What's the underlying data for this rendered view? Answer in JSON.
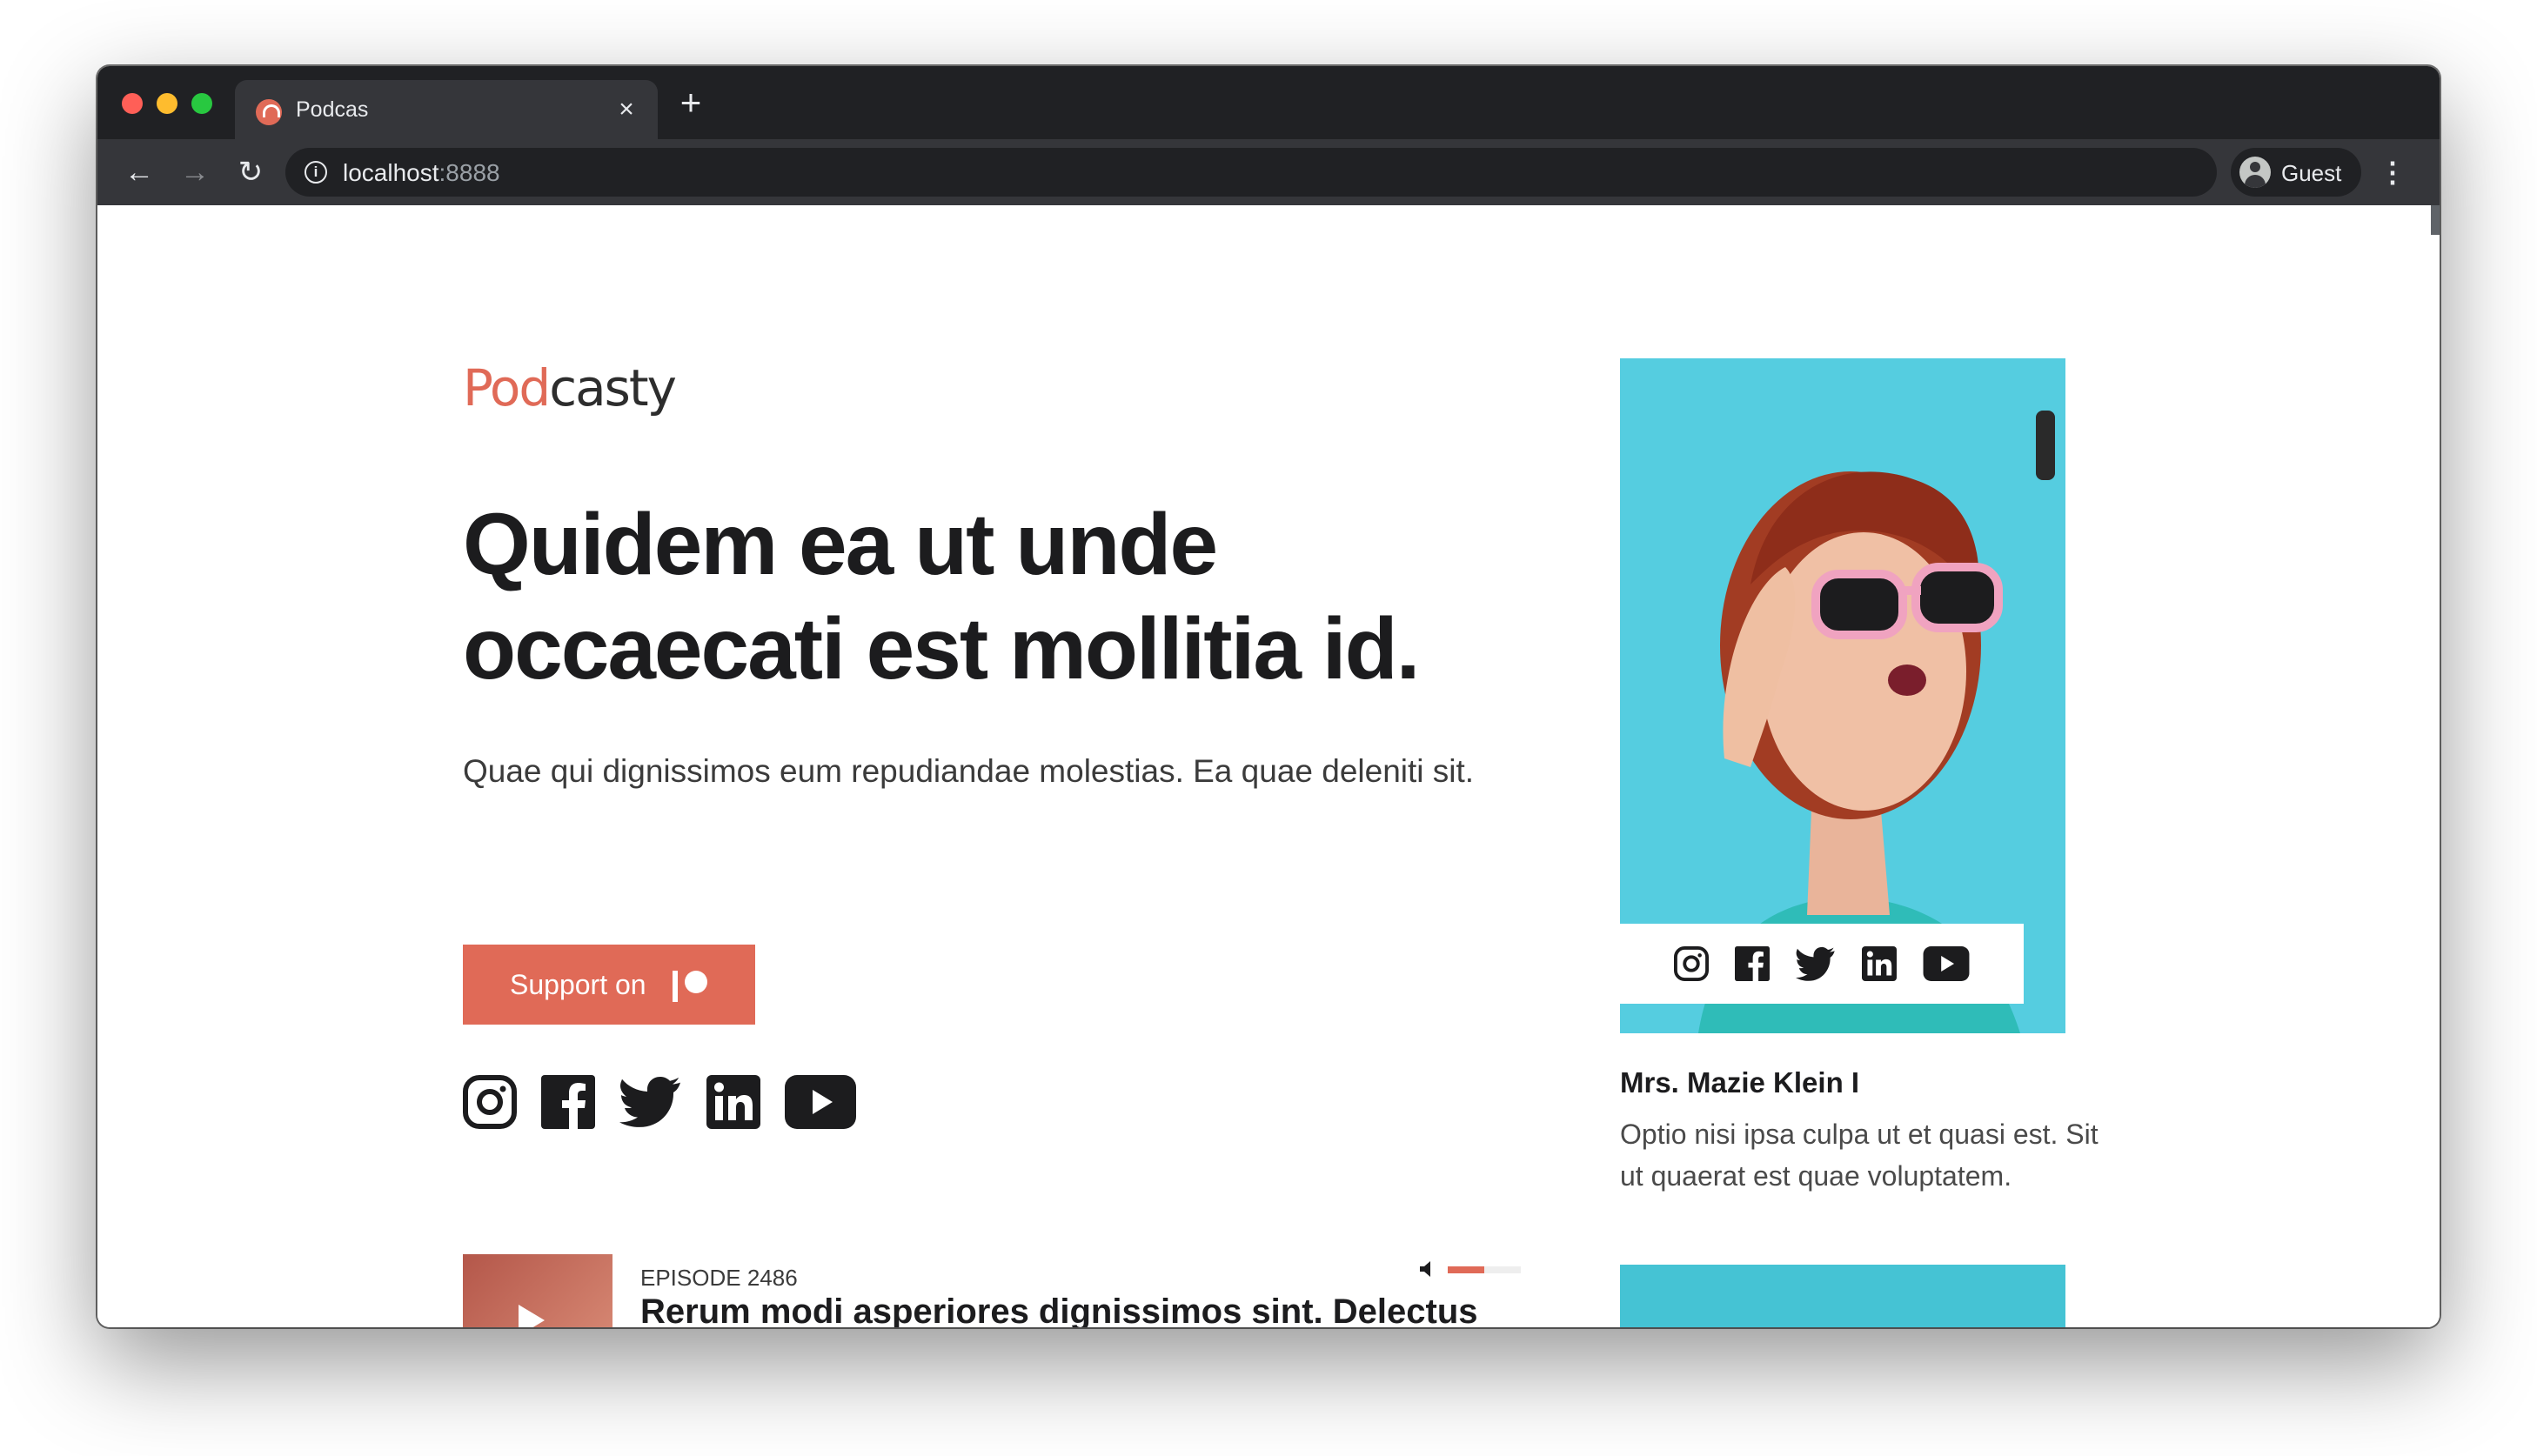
{
  "browser": {
    "tab_title": "Podcas",
    "close_glyph": "×",
    "new_tab_glyph": "+",
    "url_host": "localhost",
    "url_port": ":8888",
    "profile_label": "Guest",
    "info_glyph": "i",
    "back_glyph": "←",
    "forward_glyph": "→",
    "reload_glyph": "↻",
    "menu_glyph": "⋮"
  },
  "site": {
    "logo_part1": "Pod",
    "logo_part2": "casty",
    "brand_color": "#e06a57"
  },
  "hero": {
    "title": "Quidem ea ut unde occaecati est mollitia id.",
    "subtitle": "Quae qui dignissimos eum repudiandae molestias. Ea quae deleniti sit.",
    "support_label": "Support on"
  },
  "social_icons": [
    "instagram-icon",
    "facebook-icon",
    "twitter-icon",
    "linkedin-icon",
    "youtube-icon"
  ],
  "host": {
    "name": "Mrs. Mazie Klein I",
    "bio": "Optio nisi ipsa culpa ut et quasi est. Sit ut quaerat est quae voluptatem."
  },
  "episode": {
    "label": "EPISODE 2486",
    "title": "Rerum modi asperiores dignissimos sint. Delectus",
    "volume_level": 0.5
  }
}
